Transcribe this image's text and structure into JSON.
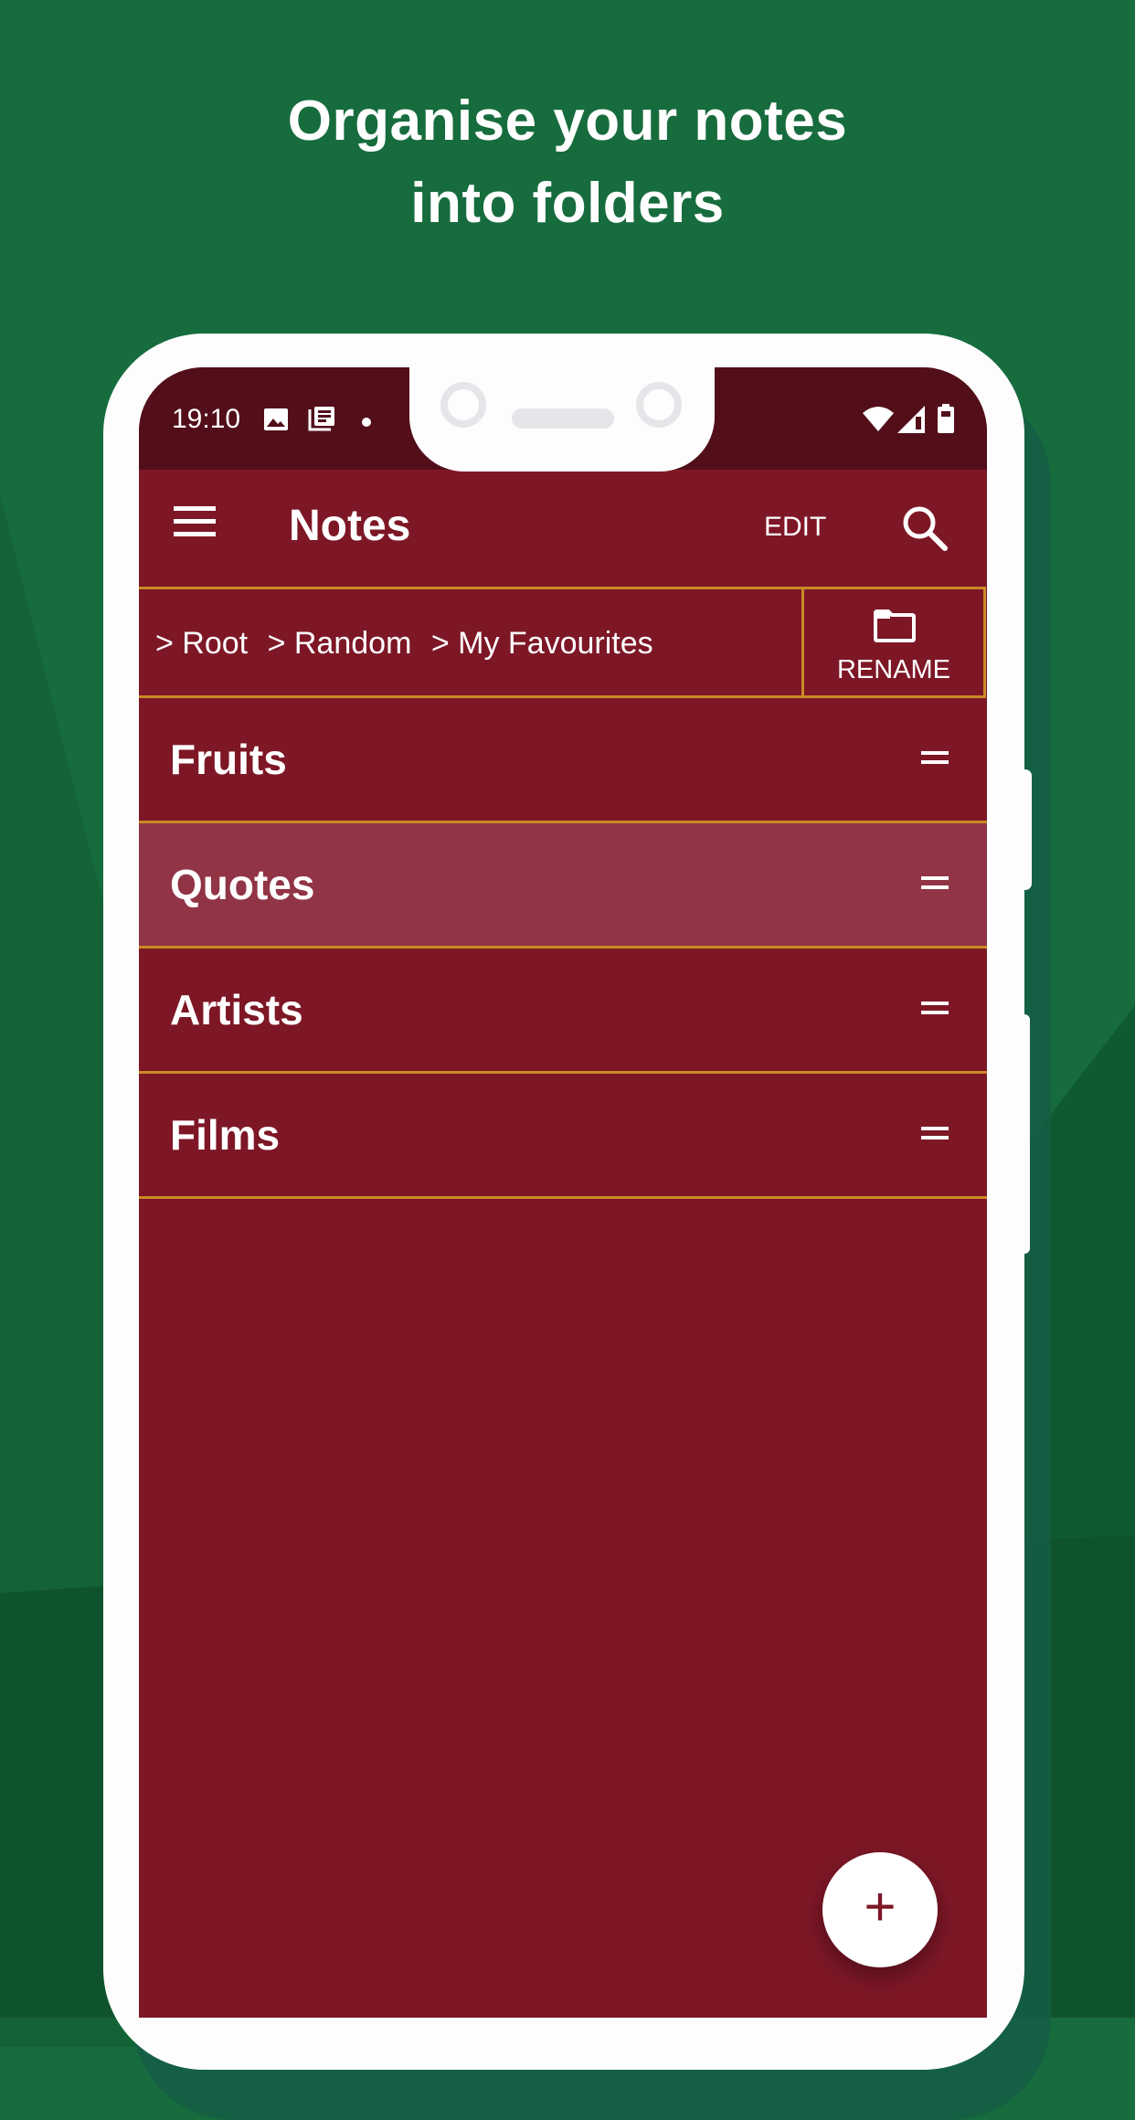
{
  "headline": {
    "line1": "Organise your notes",
    "line2": "into folders"
  },
  "status_bar": {
    "time": "19:10",
    "left_icons": [
      "image-icon",
      "news-icon",
      "dot-icon"
    ],
    "right_icons": [
      "wifi-icon",
      "signal-icon",
      "battery-icon"
    ]
  },
  "app_bar": {
    "title": "Notes",
    "edit_label": "EDIT",
    "menu_icon": "hamburger-menu-icon",
    "search_icon": "search-icon"
  },
  "breadcrumb": {
    "items": [
      "> Root",
      "> Random",
      "> My Favourites"
    ],
    "rename_label": "RENAME",
    "rename_icon": "folder-icon"
  },
  "folders": [
    {
      "name": "Fruits",
      "selected": false
    },
    {
      "name": "Quotes",
      "selected": true
    },
    {
      "name": "Artists",
      "selected": false
    },
    {
      "name": "Films",
      "selected": false
    }
  ],
  "fab": {
    "label": "+",
    "icon": "add-icon"
  },
  "colors": {
    "background_green": "#176c3e",
    "app_primary": "#7d1726",
    "status_bar": "#520f1a",
    "divider_gold": "#c98a26",
    "selected_row": "#913445"
  }
}
